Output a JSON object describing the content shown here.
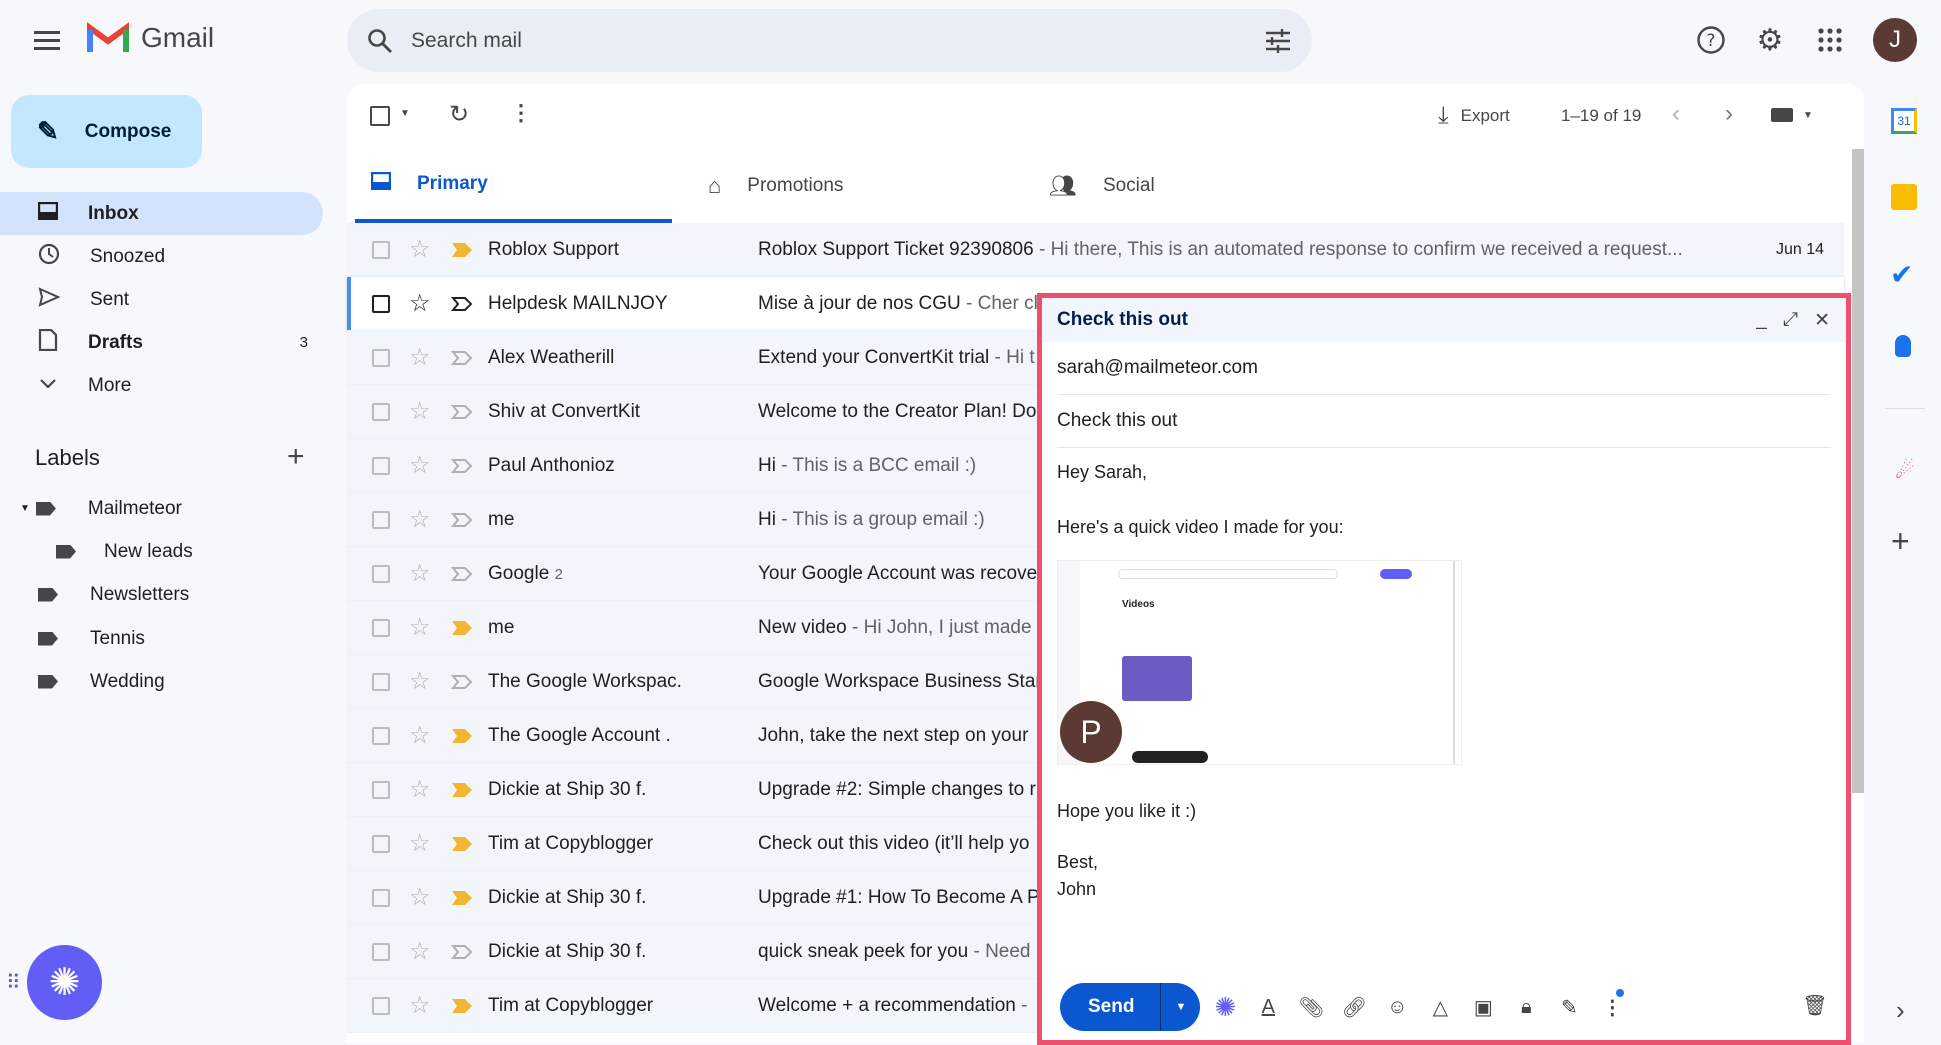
{
  "app": {
    "name": "Gmail"
  },
  "search": {
    "placeholder": "Search mail"
  },
  "account": {
    "initial": "J"
  },
  "sidebar": {
    "compose": "Compose",
    "items": [
      {
        "label": "Inbox",
        "active": true
      },
      {
        "label": "Snoozed"
      },
      {
        "label": "Sent"
      },
      {
        "label": "Drafts",
        "count": "3"
      },
      {
        "label": "More"
      }
    ],
    "labels_title": "Labels",
    "labels": [
      {
        "label": "Mailmeteor"
      },
      {
        "label": "New leads"
      },
      {
        "label": "Newsletters"
      },
      {
        "label": "Tennis"
      },
      {
        "label": "Wedding"
      }
    ]
  },
  "toolbar": {
    "export": "Export",
    "pagination": "1–19 of 19"
  },
  "tabs": [
    {
      "label": "Primary",
      "active": true
    },
    {
      "label": "Promotions"
    },
    {
      "label": "Social"
    }
  ],
  "emails": [
    {
      "sender": "Roblox Support",
      "subject": "Roblox Support Ticket 92390806",
      "snippet": " - Hi there, This is an automated response to confirm we received a request...",
      "date": "Jun 14",
      "important": true
    },
    {
      "sender": "Helpdesk MAILNJOY",
      "subject": "Mise à jour de nos CGU",
      "snippet": " - Cher cl",
      "important": false,
      "selected": true
    },
    {
      "sender": "Alex Weatherill",
      "subject": "Extend your ConvertKit trial",
      "snippet": " - Hi t",
      "important": false
    },
    {
      "sender": "Shiv at ConvertKit",
      "subject": "Welcome to the Creator Plan! Do",
      "snippet": "",
      "important": false
    },
    {
      "sender": "Paul Anthonioz",
      "subject": "Hi",
      "snippet": " - This is a BCC email :)",
      "important": false
    },
    {
      "sender": "me",
      "subject": "Hi",
      "snippet": " - This is a group email :)",
      "important": false
    },
    {
      "sender": "Google",
      "count": "2",
      "subject": "Your Google Account was recove",
      "snippet": "",
      "important": false
    },
    {
      "sender": "me",
      "subject": "New video",
      "snippet": " - Hi John, I just made",
      "important": true
    },
    {
      "sender": "The Google Workspac.",
      "subject": "Google Workspace Business Star",
      "snippet": "",
      "important": false
    },
    {
      "sender": "The Google Account .",
      "subject": "John, take the next step on your",
      "snippet": "",
      "important": true
    },
    {
      "sender": "Dickie at Ship 30 f.",
      "subject": "Upgrade #2: Simple changes to r",
      "snippet": "",
      "important": true
    },
    {
      "sender": "Tim at Copyblogger",
      "subject": "Check out this video (it’ll help yo",
      "snippet": "",
      "important": true
    },
    {
      "sender": "Dickie at Ship 30 f.",
      "subject": "Upgrade #1: How To Become A P",
      "snippet": "",
      "important": true
    },
    {
      "sender": "Dickie at Ship 30 f.",
      "subject": "quick sneak peek for you",
      "snippet": " - Need",
      "important": false
    },
    {
      "sender": "Tim at Copyblogger",
      "subject": "Welcome + a recommendation",
      "snippet": " -",
      "important": true
    }
  ],
  "compose_window": {
    "title": "Check this out",
    "to": "sarah@mailmeteor.com",
    "subject": "Check this out",
    "body": {
      "greeting": "Hey Sarah,",
      "line1": "Here's a quick video I made for you:",
      "line2": "Hope you like it :)",
      "signoff": "Best,",
      "name": "John"
    },
    "video": {
      "heading": "Videos",
      "avatar_initial": "P"
    },
    "send": "Send"
  },
  "colors": {
    "accent": "#0b57d0",
    "highlight_border": "#f04e6e",
    "important": "#f2b632"
  }
}
